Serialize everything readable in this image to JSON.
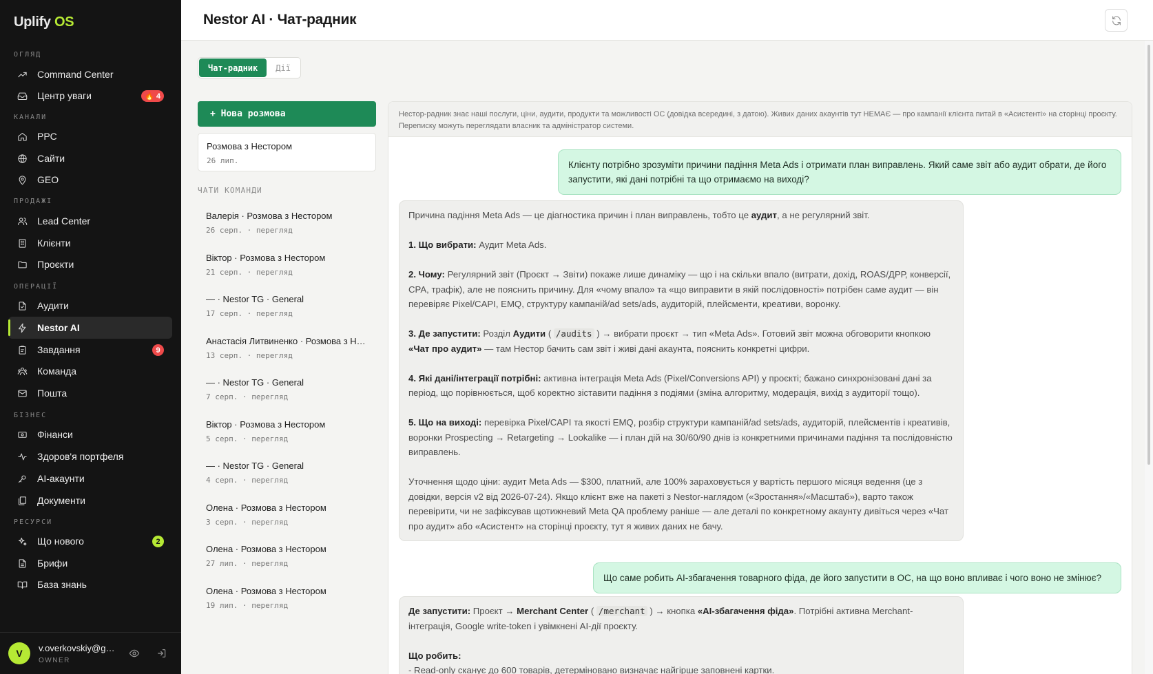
{
  "app": {
    "name": "Uplify",
    "name_accent": "OS"
  },
  "sidebar": {
    "sections": {
      "overview": "ОГЛЯД",
      "channels": "КАНАЛИ",
      "sales": "ПРОДАЖІ",
      "operations": "ОПЕРАЦІЇ",
      "business": "БІЗНЕС",
      "resources": "РЕСУРСИ"
    },
    "items": {
      "command_center": "Command Center",
      "attention": "Центр уваги",
      "attention_badge": "🔥 4",
      "ppc": "PPC",
      "sites": "Сайти",
      "geo": "GEO",
      "lead_center": "Lead Center",
      "clients": "Клієнти",
      "projects": "Проєкти",
      "audits": "Аудити",
      "nestor_ai": "Nestor AI",
      "tasks": "Завдання",
      "tasks_badge": "9",
      "team": "Команда",
      "mail": "Пошта",
      "finance": "Фінанси",
      "portfolio_health": "Здоров'я портфеля",
      "ai_accounts": "AI-акаунти",
      "documents": "Документи",
      "whats_new": "Що нового",
      "whats_new_badge": "2",
      "briefs": "Брифи",
      "knowledge_base": "База знань"
    },
    "user": {
      "initial": "V",
      "email": "v.overkovskiy@gmail.com",
      "role": "OWNER"
    }
  },
  "header": {
    "title": "Nestor AI · Чат-радник"
  },
  "tabs": [
    "Чат-радник",
    "Дії"
  ],
  "conversations": {
    "new_button": "+ Нова розмова",
    "mine": {
      "title": "Розмова з Нестором",
      "date": "26 лип."
    },
    "team_label": "ЧАТИ КОМАНДИ",
    "team": [
      {
        "title": "Валерія · Розмова з Нестором",
        "meta": "26 серп. · перегляд"
      },
      {
        "title": "Віктор · Розмова з Нестором",
        "meta": "21 серп. · перегляд"
      },
      {
        "title": "— · Nestor TG · General",
        "meta": "17 серп. · перегляд"
      },
      {
        "title": "Анастасія Литвиненко · Розмова з Нестором",
        "meta": "13 серп. · перегляд"
      },
      {
        "title": "— · Nestor TG · General",
        "meta": "7 серп. · перегляд"
      },
      {
        "title": "Віктор · Розмова з Нестором",
        "meta": "5 серп. · перегляд"
      },
      {
        "title": "— · Nestor TG · General",
        "meta": "4 серп. · перегляд"
      },
      {
        "title": "Олена · Розмова з Нестором",
        "meta": "3 серп. · перегляд"
      },
      {
        "title": "Олена · Розмова з Нестором",
        "meta": "27 лип. · перегляд"
      },
      {
        "title": "Олена · Розмова з Нестором",
        "meta": "19 лип. · перегляд"
      }
    ]
  },
  "chat": {
    "notice": "Нестор-радник знає наші послуги, ціни, аудити, продукти та можливості ОС (довідка всередині, з датою). Живих даних акаунтів тут НЕМАЄ — про кампанії клієнта питай в «Асистенті» на сторінці проєкту. Переписку можуть переглядати власник та адміністратор системи.",
    "q1": "Клієнту потрібно зрозуміти причини падіння Meta Ads і отримати план виправлень. Який саме звіт або аудит обрати, де його запустити, які дані потрібні та що отримаємо на виході?",
    "a1": {
      "p0_pre": "Причина падіння Meta Ads — це діагностика причин і план виправлень, тобто це ",
      "p0_b": "аудит",
      "p0_post": ", а не регулярний звіт.",
      "p1_b": "1. Що вибрати:",
      "p1": " Аудит Meta Ads.",
      "p2_b": "2. Чому:",
      "p2": " Регулярний звіт (Проєкт → Звіти) покаже лише динаміку — що і на скільки впало (витрати, дохід, ROAS/ДРР, конверсії, CPA, трафік), але не пояснить причину. Для «чому впало» та «що виправити в якій послідовності» потрібен саме аудит — він перевіряє Pixel/CAPI, EMQ, структуру кампаній/ad sets/ads, аудиторій, плейсменти, креативи, воронку.",
      "p3_b": "3. Де запустити:",
      "p3_a": " Розділ ",
      "p3_b2": "Аудити",
      "p3_code": "/audits",
      "p3_c": " → вибрати проєкт → тип «Meta Ads». Готовий звіт можна обговорити кнопкою ",
      "p3_b3": "«Чат про аудит»",
      "p3_d": " — там Нестор бачить сам звіт і живі дані акаунта, пояснить конкретні цифри.",
      "p4_b": "4. Які дані/інтеграції потрібні:",
      "p4": " активна інтеграція Meta Ads (Pixel/Conversions API) у проєкті; бажано синхронізовані дані за період, що порівнюється, щоб коректно зіставити падіння з подіями (зміна алгоритму, модерація, вихід з аудиторії тощо).",
      "p5_b": "5. Що на виході:",
      "p5": " перевірка Pixel/CAPI та якості EMQ, розбір структури кампаній/ad sets/ads, аудиторій, плейсментів і креативів, воронки Prospecting → Retargeting → Lookalike — і план дій на 30/60/90 днів із конкретними причинами падіння та послідовністю виправлень.",
      "p6": "Уточнення щодо ціни: аудит Meta Ads — $300, платний, але 100% зараховується у вартість першого місяця ведення (це з довідки, версія v2 від 2026-07-24). Якщо клієнт вже на пакеті з Nestor-наглядом («Зростання»/«Масштаб»), варто також перевірити, чи не зафіксував щотижневий Meta QA проблему раніше — але деталі по конкретному акаунту дивіться через «Чат про аудит» або «Асистент» на сторінці проєкту, тут я живих даних не бачу."
    },
    "q2": "Що саме робить AI-збагачення товарного фіда, де його запустити в ОС, на що воно впливає і чого воно не змінює?",
    "a2": {
      "p0_b": "Де запустити:",
      "p0_a": " Проєкт → ",
      "p0_b2": "Merchant Center",
      "p0_code": "/merchant",
      "p0_c": " → кнопка ",
      "p0_b3": "«AI-збагачення фіда»",
      "p0_d": ". Потрібні активна Merchant-інтеграція, Google write-token і увімкнені AI-дії проєкту.",
      "p1_b": "Що робить:",
      "p2": "- Read-only сканує до 600 товарів, детерміновано визначає найгірше заповнені картки."
    }
  },
  "colors": {
    "accent_green": "#1e8a57",
    "lime": "#b6e934",
    "badge_red": "#ef4a4a"
  }
}
